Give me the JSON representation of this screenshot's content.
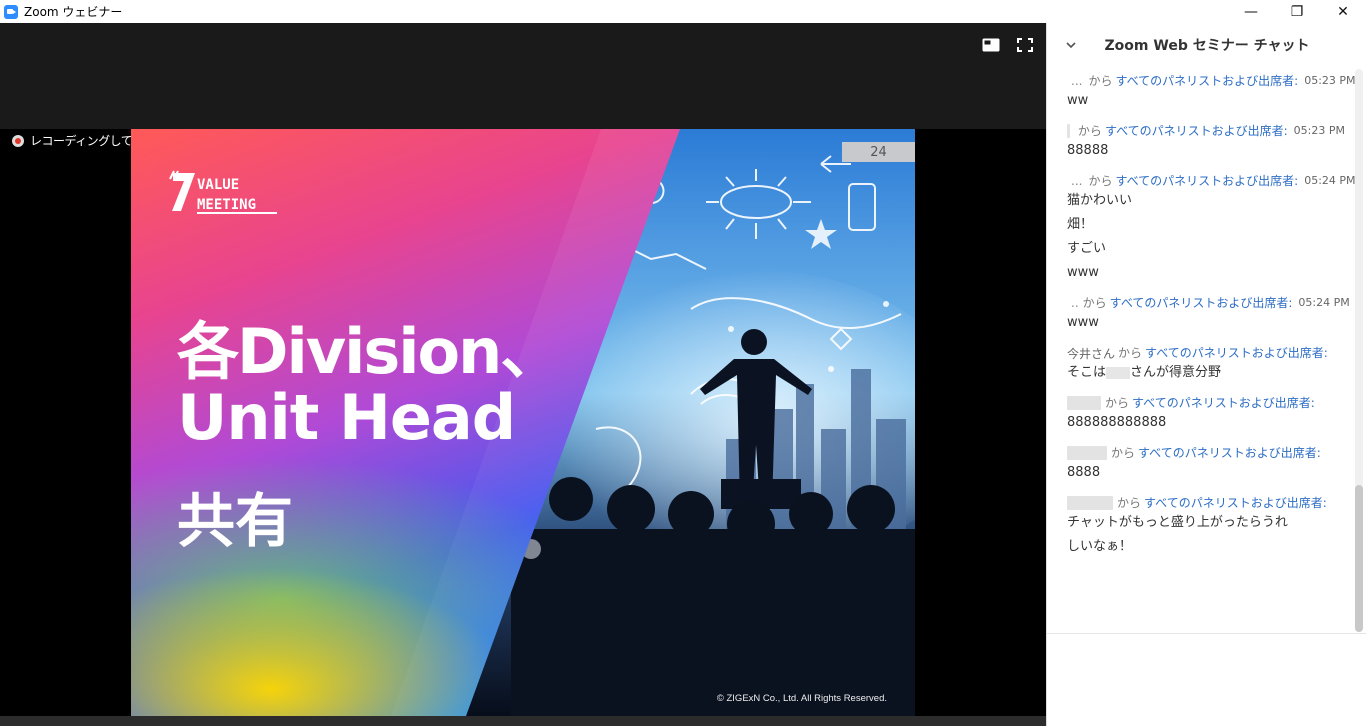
{
  "window": {
    "title": "Zoom ウェビナー",
    "controls": {
      "minimize": "—",
      "restore": "❐",
      "close": "✕"
    }
  },
  "stage": {
    "recording_text": "レコーディングしています",
    "icons": [
      "view-icon",
      "fullscreen-icon"
    ]
  },
  "slide": {
    "logo_text_1": "VALUE",
    "logo_text_2": "MEETING",
    "line1": "各Division、",
    "line2": "Unit Head",
    "line3": "共有",
    "page_number": "24",
    "copyright": "© ZIGExN Co., Ltd. All Rights Reserved."
  },
  "chat": {
    "title": "Zoom Web セミナー チャット",
    "messages": [
      {
        "sender": "",
        "sender_suffix": "...",
        "from": "から",
        "to": "すべてのパネリストおよび出席者:",
        "time": "05:23 PM",
        "lines": [
          "ww"
        ]
      },
      {
        "sender": "",
        "sender_suffix": "",
        "from": "から",
        "to": "すべてのパネリストおよび出席者:",
        "time": "05:23 PM",
        "lines": [
          "88888"
        ]
      },
      {
        "sender": "",
        "sender_suffix": "...",
        "from": "から",
        "to": "すべてのパネリストおよび出席者:",
        "time": "05:24 PM",
        "lines": [
          "猫かわいい",
          "畑！",
          "すごい",
          "www"
        ]
      },
      {
        "sender": "",
        "sender_suffix": "..",
        "from": "から",
        "to": "すべてのパネリストおよび出席者:",
        "time": "05:24 PM",
        "lines": [
          "www"
        ]
      },
      {
        "sender": "今井さん",
        "sender_suffix": "",
        "from": "から",
        "to": "すべてのパネリストおよび出席者:",
        "time": "",
        "lines_pre": "そこは",
        "lines_post": "さんが得意分野"
      },
      {
        "sender": "",
        "sender_suffix": "",
        "from": "から",
        "to": "すべてのパネリストおよび出席者:",
        "time": "",
        "lines": [
          "888888888888"
        ]
      },
      {
        "sender": "",
        "sender_suffix": "",
        "from": "から",
        "to": "すべてのパネリストおよび出席者:",
        "time": "",
        "lines": [
          "8888"
        ]
      },
      {
        "sender": "",
        "sender_suffix": "",
        "from": "から",
        "to": "すべてのパネリストおよび出席者:",
        "time": "",
        "lines": [
          "チャットがもっと盛り上がったらうれ",
          "しいなぁ！"
        ]
      }
    ]
  },
  "colors": {
    "accent_link": "#2d6dc6",
    "zoom_blue": "#2d8cff",
    "recording_red": "#e0362c"
  }
}
